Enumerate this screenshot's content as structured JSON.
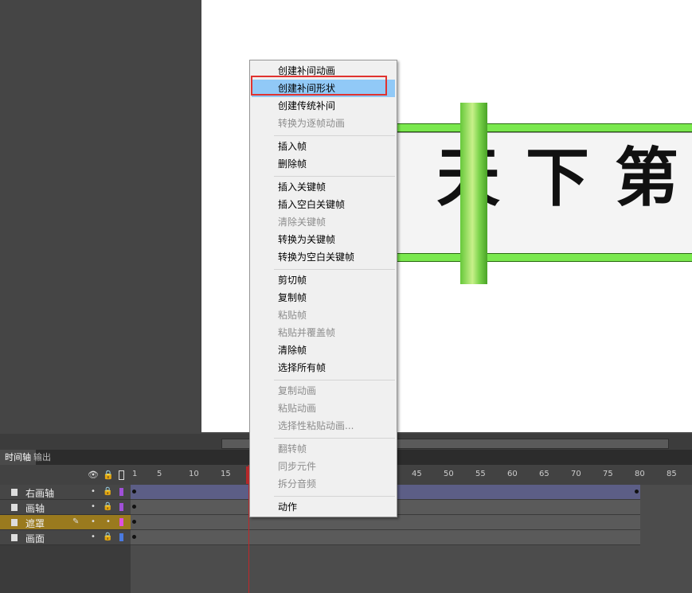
{
  "stage": {
    "glyphs": [
      "天",
      "下",
      "第"
    ],
    "colors": {
      "rail": "#7ae84e",
      "rod": "#8cdc52",
      "paper": "#f4f4f4",
      "stage": "#ffffff"
    }
  },
  "timeline": {
    "tabs": [
      "时间轴",
      "输出"
    ],
    "ruler_ticks": [
      "1",
      "5",
      "10",
      "15",
      "45",
      "50",
      "55",
      "60",
      "65",
      "70",
      "75",
      "80",
      "85"
    ],
    "header_icons": [
      "eye-icon",
      "lock-icon",
      "outline-icon"
    ],
    "layers": [
      {
        "name": "右画轴",
        "color": "#a050d8",
        "selected": false
      },
      {
        "name": "画轴",
        "color": "#a050d8",
        "selected": false
      },
      {
        "name": "遮罩",
        "color": "#e050e0",
        "selected": true
      },
      {
        "name": "画面",
        "color": "#4a7ae0",
        "selected": false
      }
    ],
    "current_frame": 15
  },
  "menu": {
    "items": [
      {
        "label": "创建补间动画",
        "disabled": false
      },
      {
        "label": "创建补间形状",
        "disabled": false,
        "highlighted": true
      },
      {
        "label": "创建传统补间",
        "disabled": false
      },
      {
        "label": "转换为逐帧动画",
        "disabled": true
      },
      {
        "label": "插入帧",
        "disabled": false
      },
      {
        "label": "删除帧",
        "disabled": false
      },
      {
        "label": "插入关键帧",
        "disabled": false
      },
      {
        "label": "插入空白关键帧",
        "disabled": false
      },
      {
        "label": "清除关键帧",
        "disabled": true
      },
      {
        "label": "转换为关键帧",
        "disabled": false
      },
      {
        "label": "转换为空白关键帧",
        "disabled": false
      },
      {
        "label": "剪切帧",
        "disabled": false
      },
      {
        "label": "复制帧",
        "disabled": false
      },
      {
        "label": "粘贴帧",
        "disabled": true
      },
      {
        "label": "粘贴并覆盖帧",
        "disabled": true
      },
      {
        "label": "清除帧",
        "disabled": false
      },
      {
        "label": "选择所有帧",
        "disabled": false
      },
      {
        "label": "复制动画",
        "disabled": true
      },
      {
        "label": "粘贴动画",
        "disabled": true
      },
      {
        "label": "选择性粘贴动画...",
        "disabled": true
      },
      {
        "label": "翻转帧",
        "disabled": true
      },
      {
        "label": "同步元件",
        "disabled": true
      },
      {
        "label": "拆分音频",
        "disabled": true
      },
      {
        "label": "动作",
        "disabled": false
      }
    ]
  }
}
